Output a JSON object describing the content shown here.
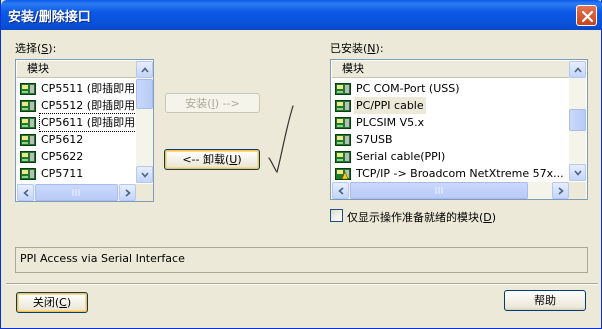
{
  "window": {
    "title": "安装/删除接口"
  },
  "selection": {
    "label": "选择",
    "label_key": "S",
    "header": "模块",
    "items": [
      {
        "label": "CP5511 (即插即用)"
      },
      {
        "label": "CP5512 (即插即用)"
      },
      {
        "label": "CP5611 (即插即用)"
      },
      {
        "label": "CP5612"
      },
      {
        "label": "CP5622"
      },
      {
        "label": "CP5711"
      }
    ]
  },
  "installed": {
    "label": "已安装",
    "label_key": "N",
    "header": "模块",
    "items": [
      {
        "label": "PC COM-Port (USS)"
      },
      {
        "label": "PC/PPI cable"
      },
      {
        "label": "PLCSIM V5.x"
      },
      {
        "label": "S7USB"
      },
      {
        "label": "Serial cable(PPI)"
      },
      {
        "label": "TCP/IP -> Broadcom NetXtreme 57x..."
      }
    ]
  },
  "buttons": {
    "install_prefix": "安装(",
    "install_key": "I",
    "install_suffix": ") -->",
    "uninstall_prefix": "<-- 卸载(",
    "uninstall_key": "U",
    "uninstall_suffix": ")",
    "close_prefix": "关闭(",
    "close_key": "C",
    "close_suffix": ")",
    "help": "帮助"
  },
  "checkbox": {
    "label": "仅显示操作准备就绪的模块",
    "key": "D",
    "checked": false
  },
  "description": "PPI Access via Serial Interface",
  "icons": {
    "interface": "network-card-icon",
    "warning_interface": "network-card-warning-icon",
    "close": "close-icon"
  },
  "colors": {
    "titlebar": "#0a58e6",
    "dialog_bg": "#ece9d8",
    "close_button": "#d9532e"
  }
}
